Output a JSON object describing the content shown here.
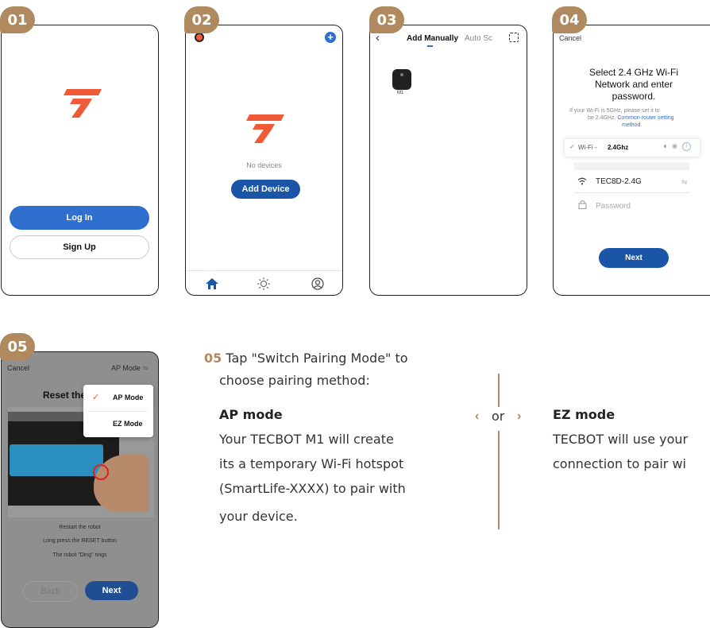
{
  "steps": {
    "s1": "01",
    "s2": "02",
    "s3": "03",
    "s4": "04",
    "s5": "05"
  },
  "screen1": {
    "login": "Log In",
    "signup": "Sign Up"
  },
  "screen2": {
    "no_devices": "No devices",
    "add_device": "Add Device"
  },
  "screen3": {
    "tab_manual": "Add Manually",
    "tab_auto": "Auto Sc",
    "device_label": "M1"
  },
  "screen4": {
    "cancel": "Cancel",
    "title_l1": "Select 2.4 GHz Wi-Fi",
    "title_l2": "Network and enter",
    "title_l3": "password.",
    "note_l1": "If your Wi-Fi is 5GHz, please set it to",
    "note_l2": "be 2.4GHz.",
    "note_link_l1": "Common router setting",
    "note_link_l2": "method",
    "wifi_prefix": "Wi-Fi - ",
    "wifi_band": "2.4Ghz",
    "ssid": "TEC8D-2.4G",
    "password_placeholder": "Password",
    "next": "Next"
  },
  "screen5": {
    "cancel": "Cancel",
    "mode": "AP Mode",
    "reset_title": "Reset the",
    "menu_ap": "AP Mode",
    "menu_ez": "EZ Mode",
    "instr1": "Restart the robot",
    "instr2": "Long press the RESET button",
    "instr3": "The robot \"Ding\" rings",
    "back": "Back",
    "next": "Next"
  },
  "instructions": {
    "step": "05",
    "line1": "Tap \"Switch Pairing Mode\" to",
    "line2": "choose pairing method:",
    "ap_title": "AP mode",
    "ap_l1": "Your TECBOT M1 will create",
    "ap_l2": "its a temporary  Wi-Fi hotspot",
    "ap_l3": "(SmartLife-XXXX)  to pair with",
    "ap_l4": "your device.",
    "or": "or",
    "ez_title": "EZ mode",
    "ez_l1": "TECBOT will use your",
    "ez_l2": "connection to pair wi"
  },
  "colors": {
    "brand": "#f05a37",
    "blue": "#2e6fd0",
    "navy": "#1a55a8",
    "accent": "#b08a5e"
  }
}
